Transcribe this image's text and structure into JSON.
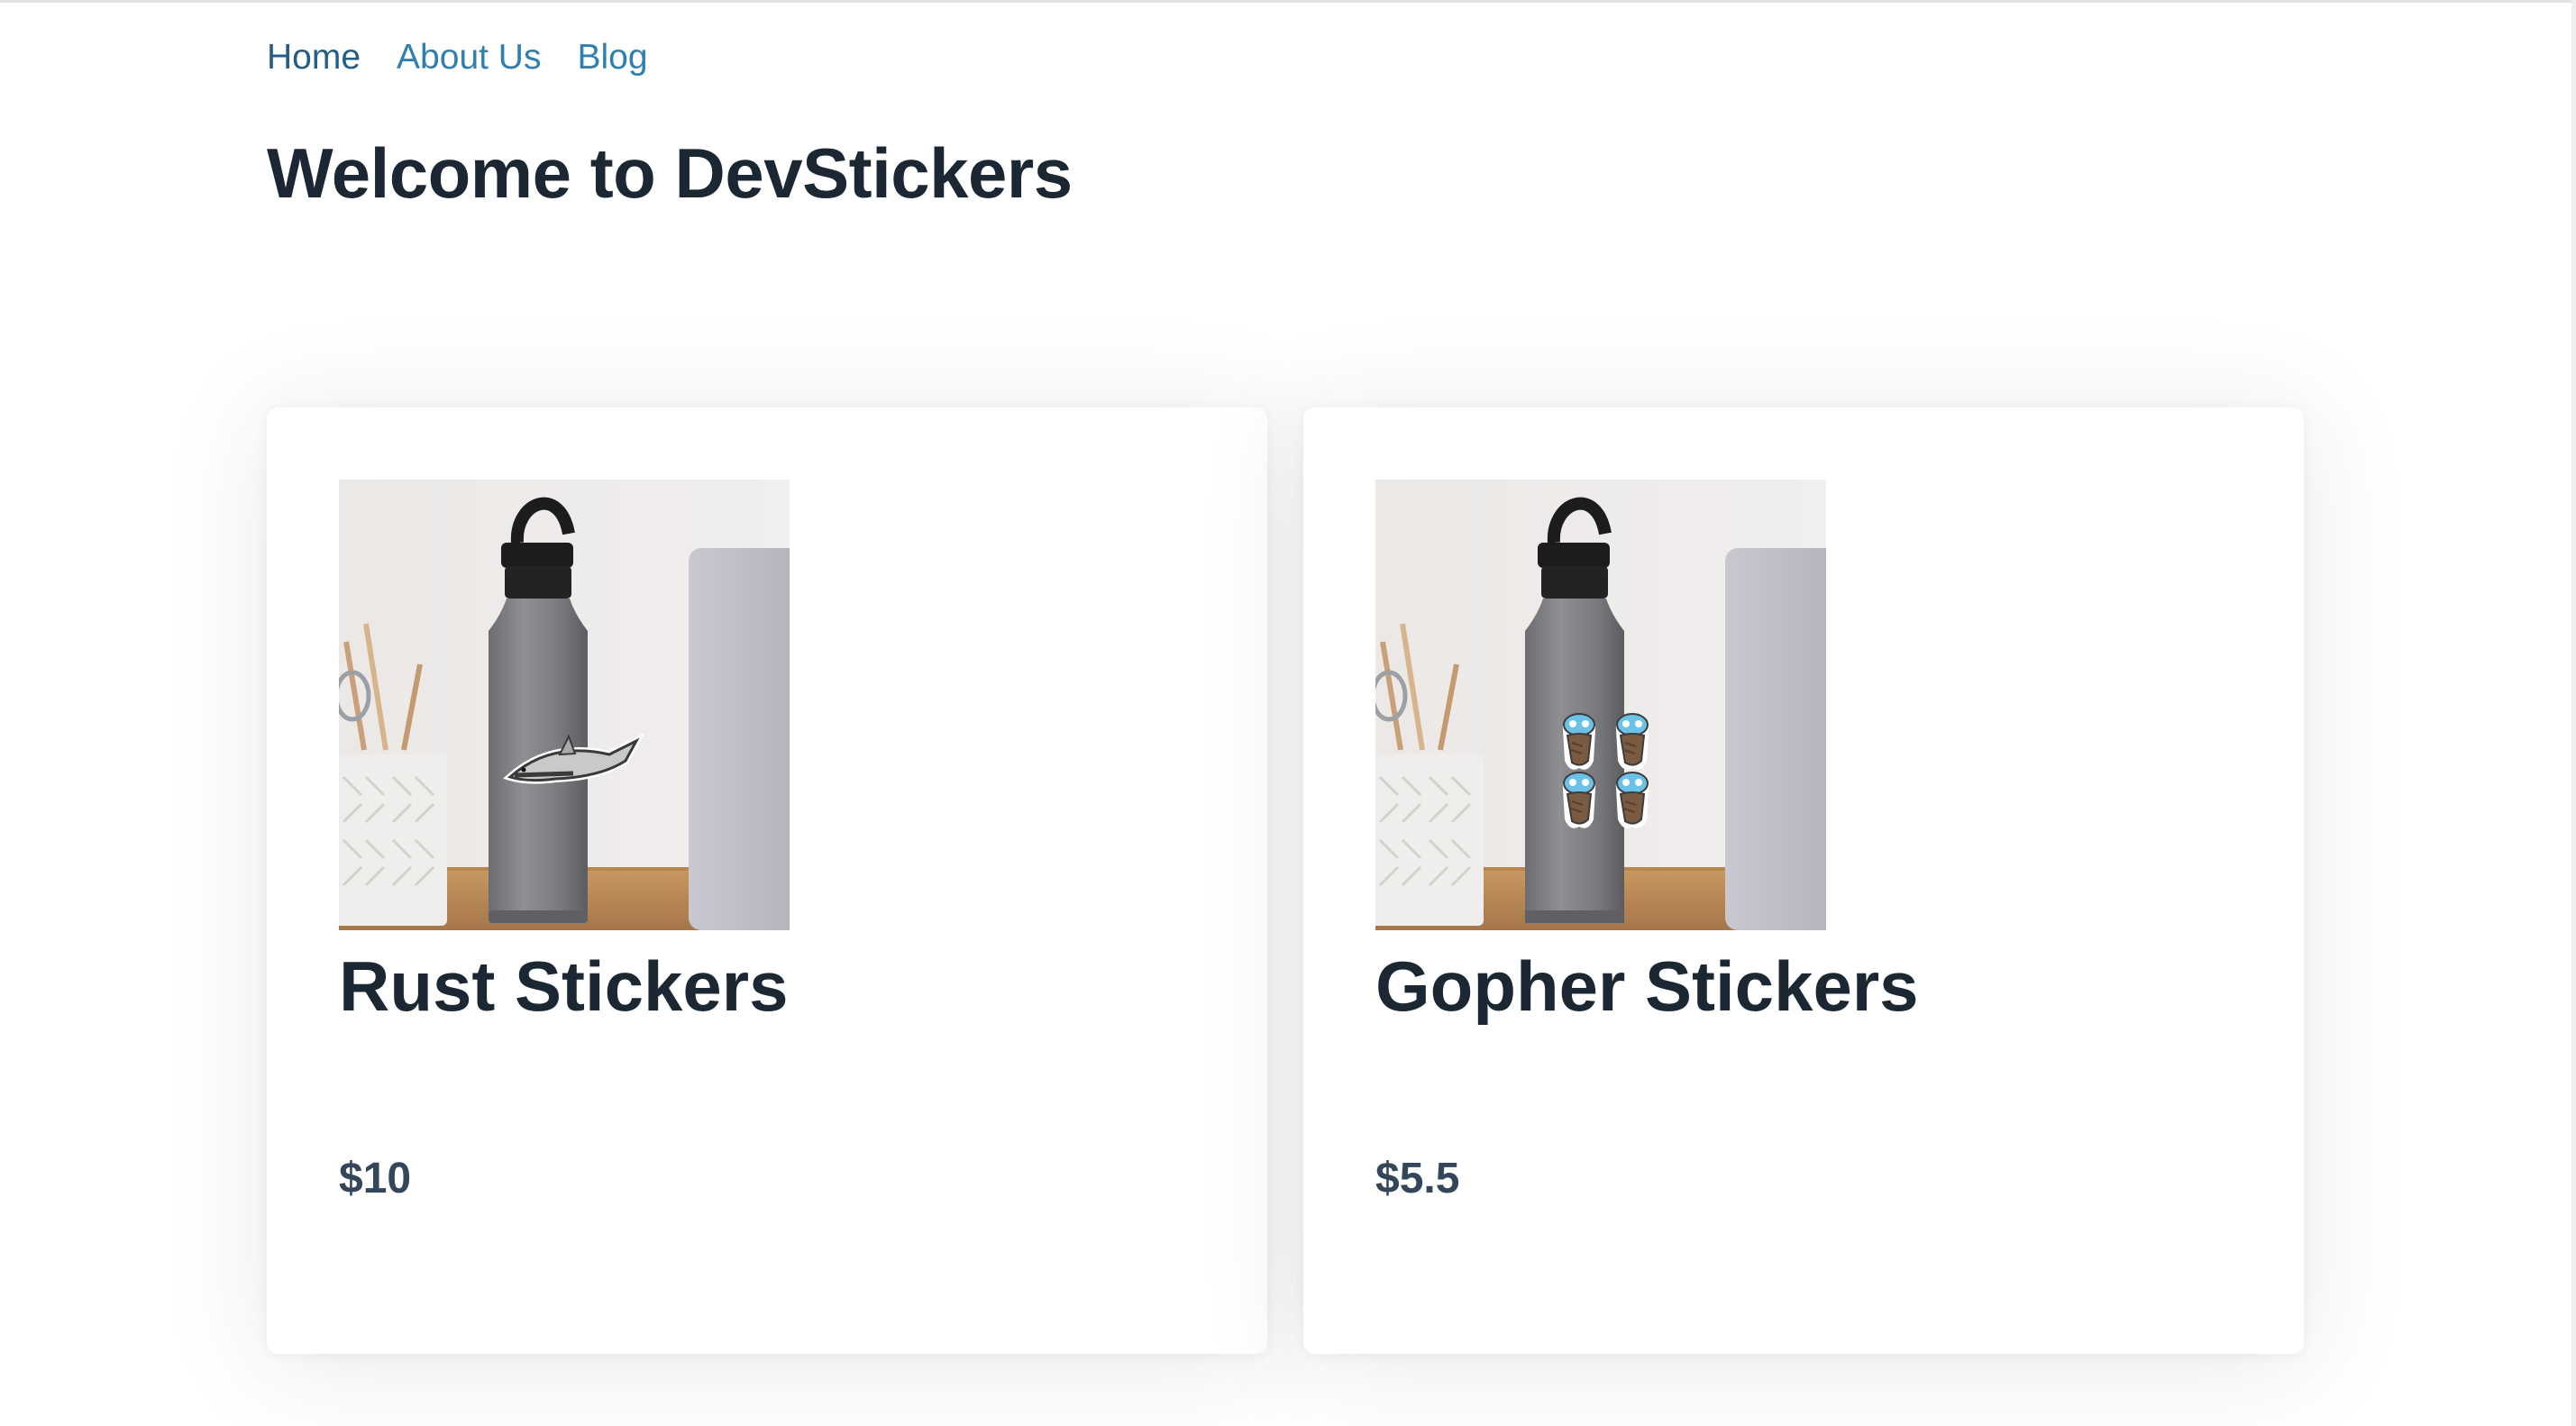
{
  "nav": {
    "items": [
      {
        "label": "Home"
      },
      {
        "label": "About Us"
      },
      {
        "label": "Blog"
      }
    ]
  },
  "page": {
    "title": "Welcome to DevStickers"
  },
  "products": [
    {
      "name": "Rust Stickers",
      "price": "$10",
      "sticker_icon": "shark-icon"
    },
    {
      "name": "Gopher Stickers",
      "price": "$5.5",
      "sticker_icon": "gopher-icon"
    }
  ],
  "colors": {
    "nav_link": "#2f7fb0",
    "heading": "#1b2733",
    "price": "#33465a"
  }
}
